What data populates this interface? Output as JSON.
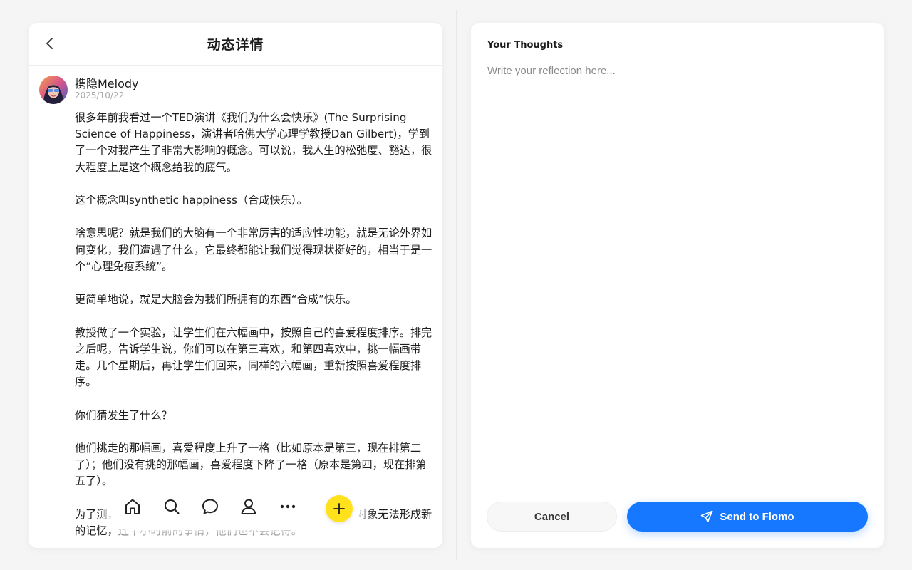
{
  "feed": {
    "header_title": "动态详情",
    "post": {
      "author": "携隐Melody",
      "date": "2025/10/22",
      "paragraphs": [
        "很多年前我看过一个TED演讲《我们为什么会快乐》(The Surprising Science of Happiness，演讲者哈佛大学心理学教授Dan Gilbert)，学到了一个对我产生了非常大影响的概念。可以说，我人生的松弛度、豁达，很大程度上是这个概念给我的底气。",
        "这个概念叫synthetic happiness（合成快乐）。",
        "啥意思呢？就是我们的大脑有一个非常厉害的适应性功能，就是无论外界如何变化，我们遭遇了什么，它最终都能让我们觉得现状挺好的，相当于是一个“心理免疫系统”。",
        "更简单地说，就是大脑会为我们所拥有的东西“合成”快乐。",
        "教授做了一个实验，让学生们在六幅画中，按照自己的喜爱程度排序。排完之后呢，告诉学生说，你们可以在第三喜欢，和第四喜欢中，挑一幅画带走。几个星期后，再让学生们回来，同样的六幅画，重新按照喜爱程度排序。",
        "你们猜发生了什么？",
        "他们挑走的那幅画，喜爱程度上升了一格（比如原本是第三，现在排第二了）；他们没有挑的那幅画，喜爱程度下降了一格（原本是第四，现在排第五了）。",
        "为了测，一群患有失忆症的人，做了类似的实验。这群实验对象无法形成新的记忆，连半小时前的事情，他们也不会记得。"
      ]
    }
  },
  "nav": {
    "icons": [
      "home-icon",
      "search-icon",
      "chat-icon",
      "profile-icon",
      "more-icon"
    ],
    "fab_icon": "plus-icon",
    "fab_color": "#ffe11c"
  },
  "composer": {
    "label": "Your Thoughts",
    "placeholder": "Write your reflection here...",
    "cancel_label": "Cancel",
    "send_label": "Send to Flomo",
    "send_icon": "send-icon",
    "accent_color": "#1677ff"
  }
}
